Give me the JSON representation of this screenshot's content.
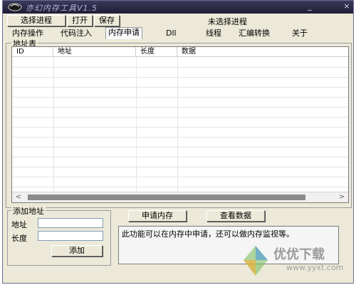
{
  "window": {
    "title": "亦幻内存工具V1.5",
    "minimize_icon": "minimize-icon",
    "close_icon": "close-icon"
  },
  "toolbar": {
    "select_process": "选择进程",
    "open": "打开",
    "save": "保存",
    "status": "未选择进程"
  },
  "tabs": [
    {
      "label": "内存操作"
    },
    {
      "label": "代码注入"
    },
    {
      "label": "内存申请",
      "active": true
    },
    {
      "label": "Dll"
    },
    {
      "label": "线程"
    },
    {
      "label": "汇编转换"
    },
    {
      "label": "关于"
    }
  ],
  "address_table": {
    "group_label": "地址表",
    "columns": [
      "ID",
      "地址",
      "长度",
      "数据"
    ],
    "rows": []
  },
  "add_address": {
    "group_label": "添加地址",
    "address_label": "地址",
    "address_value": "",
    "length_label": "长度",
    "length_value": "",
    "add_button": "添加"
  },
  "actions": {
    "apply_memory": "申请内存",
    "view_data": "查看数据"
  },
  "info_text": "此功能可以在内存中申请，还可以做内存监视等。",
  "watermark": {
    "text": "优优下载",
    "url": "www.yyxt.com"
  },
  "colors": {
    "title_bar": "#2a2a48",
    "window_bg": "#ece9d8",
    "active_tab": "#f9f9f9"
  }
}
